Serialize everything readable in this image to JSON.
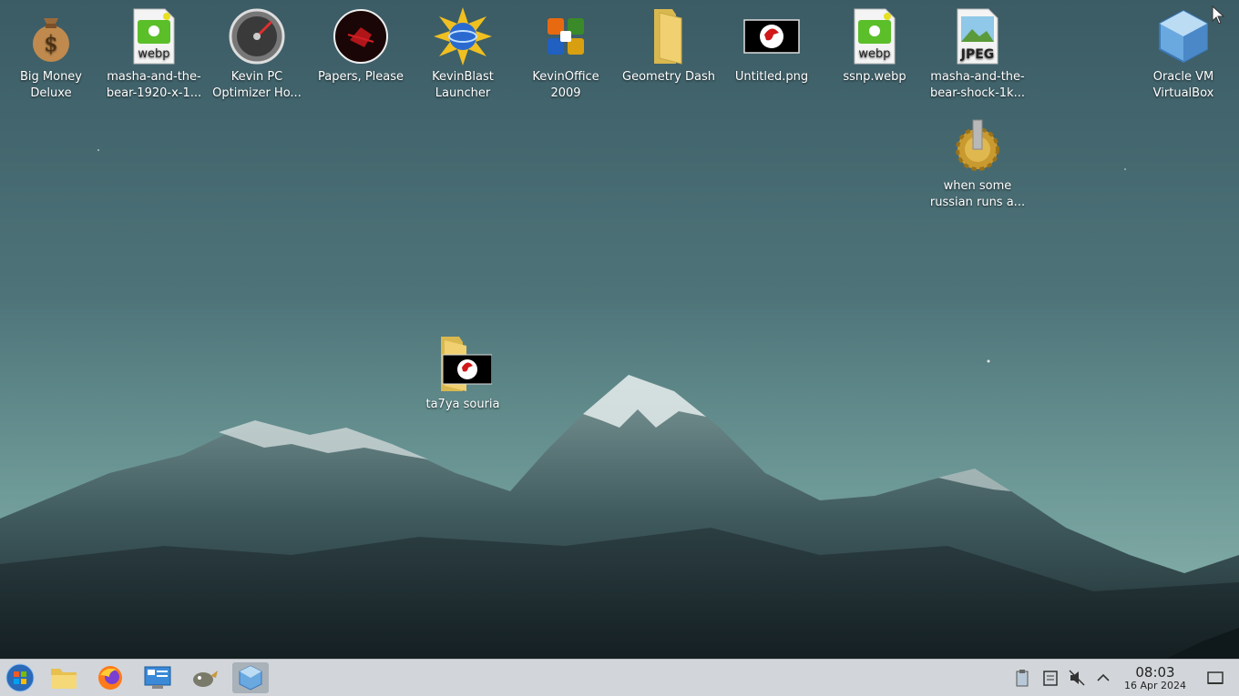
{
  "desktop_icons": {
    "big_money": "Big Money Deluxe",
    "masha1": "masha-and-the-bear-1920-x-1...",
    "kevin_pc": "Kevin PC Optimizer Ho...",
    "papers": "Papers, Please",
    "kevinblast": "KevinBlast Launcher",
    "kevinoffice": "KevinOffice 2009",
    "geometry": "Geometry Dash",
    "untitled": "Untitled.png",
    "ssnp": "ssnp.webp",
    "masha2": "masha-and-the-bear-shock-1k...",
    "virtualbox": "Oracle VM VirtualBox",
    "when_some": "when some russian runs a...",
    "ta7ya": "ta7ya souria"
  },
  "badges": {
    "webp": "webp",
    "jpeg": "JPEG"
  },
  "clock": {
    "time": "08:03",
    "date": "16 Apr 2024"
  },
  "colors": {
    "taskbar": "#d2d6da",
    "folder": "#f0d070",
    "webp_green": "#5bbf2a"
  }
}
